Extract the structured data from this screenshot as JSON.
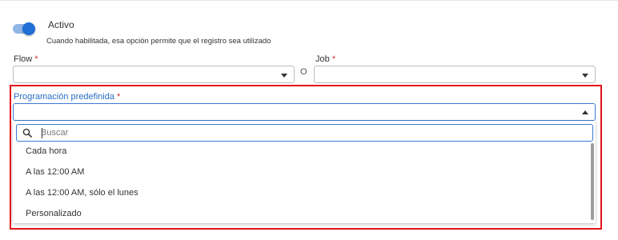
{
  "toggle": {
    "label": "Activo",
    "helper": "Cuando habilitada, esa opción permite que el registro sea utilizado",
    "checked": true
  },
  "flow": {
    "label": "Flow",
    "required_mark": "*",
    "value": ""
  },
  "or_label": "O",
  "job": {
    "label": "Job",
    "required_mark": "*",
    "value": ""
  },
  "schedule": {
    "label": "Programación predefinida",
    "required_mark": "*",
    "value": "",
    "search_placeholder": "Buscar",
    "options": [
      {
        "label": "Cada hora"
      },
      {
        "label": "A las 12:00 AM"
      },
      {
        "label": "A las 12:00 AM, sólo el lunes"
      },
      {
        "label": "Personalizado"
      }
    ]
  },
  "colors": {
    "accent": "#1f6fd6",
    "highlight": "#e3121b",
    "required": "#d32f2f",
    "label_focus": "#2a6ec8"
  },
  "icons": {
    "search": "search-icon",
    "caret": "chevron-down-icon",
    "caret_open": "chevron-up-icon"
  }
}
